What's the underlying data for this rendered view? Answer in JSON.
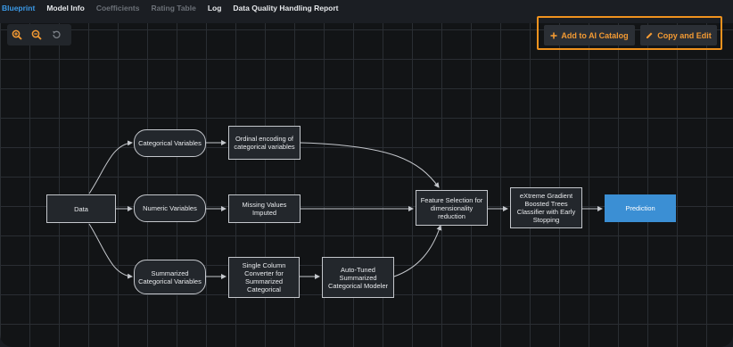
{
  "tabs": [
    {
      "label": "Blueprint",
      "state": "active"
    },
    {
      "label": "Model Info",
      "state": "normal"
    },
    {
      "label": "Coefficients",
      "state": "muted"
    },
    {
      "label": "Rating Table",
      "state": "muted"
    },
    {
      "label": "Log",
      "state": "normal"
    },
    {
      "label": "Data Quality Handling Report",
      "state": "normal"
    }
  ],
  "zoom_controls": {
    "zoom_in_icon": "zoom-in-icon",
    "zoom_out_icon": "zoom-out-icon",
    "reset_icon": "reset-icon"
  },
  "actions": {
    "add_to_catalog": "Add to AI Catalog",
    "copy_and_edit": "Copy and Edit",
    "highlight_color": "#f0921e",
    "accent_color": "#f39a33"
  },
  "nodes": {
    "data": "Data",
    "categorical_variables": "Categorical Variables",
    "numeric_variables": "Numeric Variables",
    "summarized_categorical_variables": "Summarized Categorical Variables",
    "ordinal_encoding": "Ordinal encoding of categorical variables",
    "missing_values_imputed": "Missing Values Imputed",
    "single_column_converter": "Single Column Converter for Summarized Categorical",
    "auto_tuned_modeler": "Auto-Tuned Summarized Categorical Modeler",
    "feature_selection": "Feature Selection for dimensionality reduction",
    "xgboost_classifier": "eXtreme Gradient Boosted Trees Classifier with Early Stopping",
    "prediction": "Prediction"
  },
  "colors": {
    "prediction_fill": "#3b8fd4",
    "active_tab": "#3b9ae8"
  }
}
